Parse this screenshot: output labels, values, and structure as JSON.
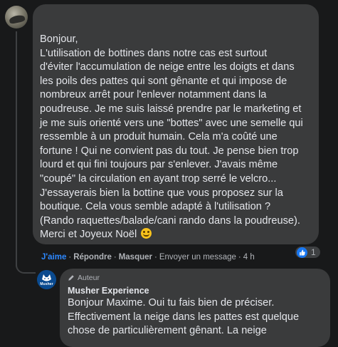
{
  "comment": {
    "text": "Bonjour,\nL'utilisation de bottines dans notre cas est surtout\nd'éviter l'accumulation de neige entre les doigts et dans\nles poils des pattes qui sont gênante et qui impose de\nnombreux arrêt pour l'enlever notamment dans la\npoudreuse. Je me suis laissé prendre par le marketing et\nje me suis orienté vers une \"bottes\" avec une semelle qui\nressemble à un produit humain. Cela m'a coûté une\nfortune ! Qui ne convient pas du tout. Je pense bien trop\nlourd et qui fini toujours par s'enlever. J'avais même\n\"coupé\" la circulation en ayant trop serré le velcro...\nJ'essayerais bien la bottine que vous proposez sur la\nboutique. Cela vous semble adapté à l'utilisation ?\n(Rando raquettes/balade/cani rando dans la poudreuse).\nMerci et Joyeux Noël",
    "emoji": "slightly-smiling-face",
    "actions": {
      "like": "J'aime",
      "reply": "Répondre",
      "hide": "Masquer",
      "send_message": "Envoyer un message",
      "time": "4 h"
    },
    "reaction": {
      "icon": "thumbs-up-icon",
      "count": "1"
    }
  },
  "reply": {
    "badge": "Auteur",
    "author": "Musher Experience",
    "avatar_text": "Musher",
    "text": "Bonjour Maxime. Oui tu fais bien de préciser.\nEffectivement la neige dans les pattes est quelque\nchose de particulièrement gênant. La neige"
  },
  "colors": {
    "background": "#18191a",
    "bubble": "#3a3b3c",
    "text": "#e4e6eb",
    "muted": "#b0b3b8",
    "like_blue": "#2d88ff"
  }
}
